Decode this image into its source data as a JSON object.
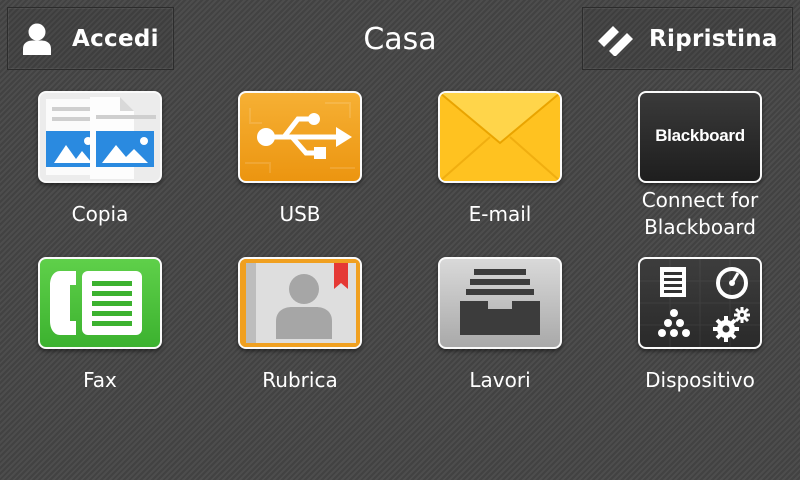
{
  "header": {
    "title": "Casa",
    "login_label": "Accedi",
    "reset_label": "Ripristina"
  },
  "apps": [
    {
      "label": "Copia",
      "icon": "copy-icon"
    },
    {
      "label": "USB",
      "icon": "usb-icon"
    },
    {
      "label": "E-mail",
      "icon": "envelope-icon"
    },
    {
      "label_line1": "Connect for",
      "label_line2": "Blackboard",
      "tile_text": "Blackboard",
      "icon": "blackboard-logo"
    },
    {
      "label": "Fax",
      "icon": "fax-icon"
    },
    {
      "label": "Rubrica",
      "icon": "address-book-icon"
    },
    {
      "label": "Lavori",
      "icon": "jobs-tray-icon"
    },
    {
      "label": "Dispositivo",
      "icon": "device-icon"
    }
  ],
  "colors": {
    "background": "#454545",
    "usb": "#f2a31a",
    "email": "#ffbe12",
    "fax": "#4cc23c",
    "rubrica": "#f0a020",
    "copy": "#2a8ae0"
  }
}
